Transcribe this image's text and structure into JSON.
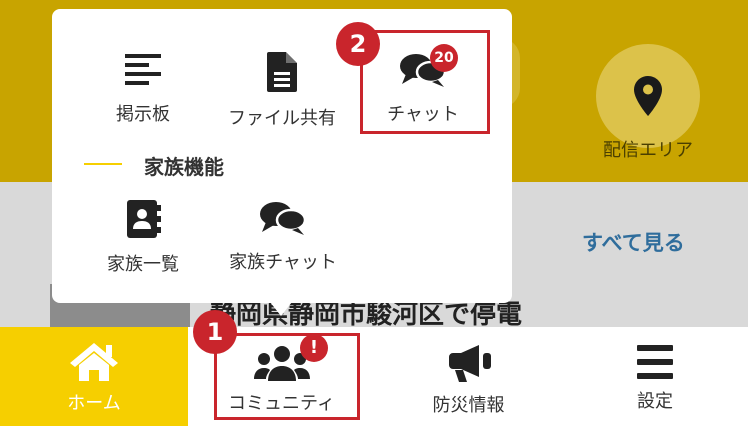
{
  "background": {
    "area_label": "配信エリア",
    "see_all": "すべて見る",
    "news_title": "静岡県静岡市駿河区で停電"
  },
  "popup": {
    "items": [
      {
        "label": "掲示板",
        "icon": "list-icon"
      },
      {
        "label": "ファイル共有",
        "icon": "file-icon"
      },
      {
        "label": "チャット",
        "icon": "chat-icon",
        "badge": "20"
      }
    ],
    "section_title": "家族機能",
    "family_items": [
      {
        "label": "家族一覧",
        "icon": "address-book-icon"
      },
      {
        "label": "家族チャット",
        "icon": "chat-icon"
      }
    ]
  },
  "steps": {
    "step1": "1",
    "step2": "2"
  },
  "bottom_nav": {
    "items": [
      {
        "label": "ホーム",
        "icon": "home-icon",
        "active": true
      },
      {
        "label": "コミュニティ",
        "icon": "users-icon",
        "badge": "!"
      },
      {
        "label": "防災情報",
        "icon": "megaphone-icon"
      },
      {
        "label": "設定",
        "icon": "menu-icon"
      }
    ]
  },
  "colors": {
    "accent_yellow": "#f6cf00",
    "highlight_red": "#c9252c",
    "text_dark": "#333333"
  }
}
